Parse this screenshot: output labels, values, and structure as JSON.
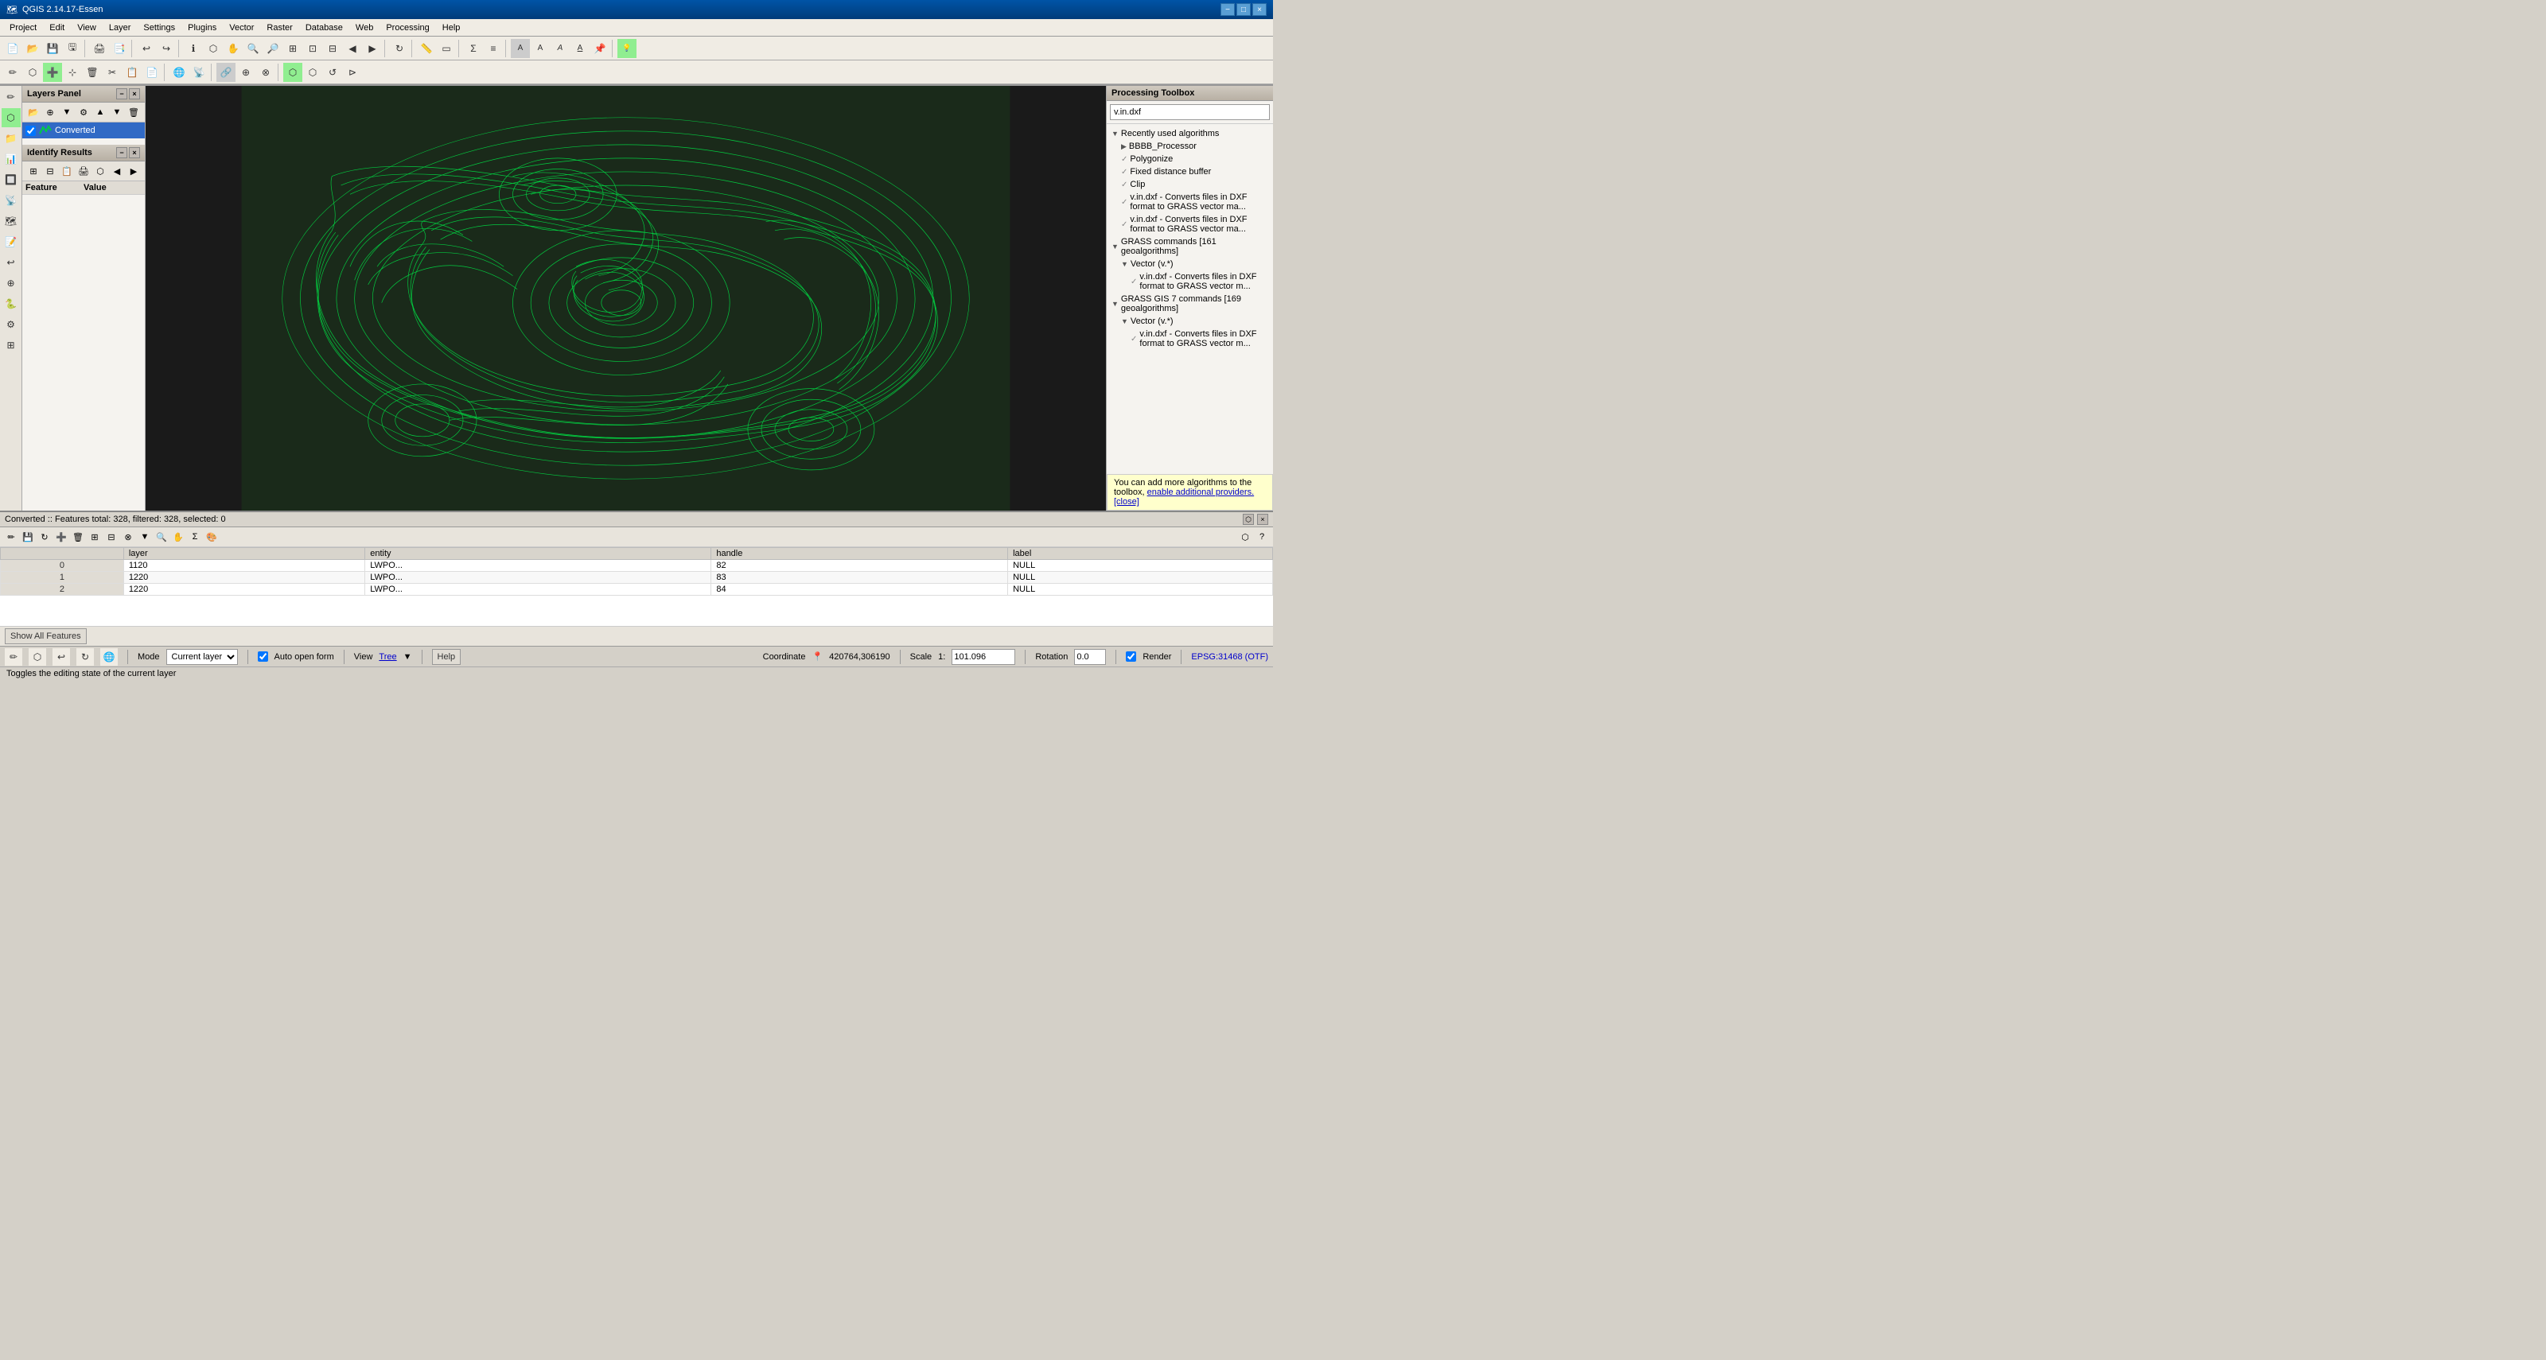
{
  "window": {
    "title": "QGIS 2.14.17-Essen",
    "minimize": "−",
    "maximize": "□",
    "close": "×"
  },
  "menu": {
    "items": [
      "Project",
      "Edit",
      "View",
      "Layer",
      "Settings",
      "Plugins",
      "Vector",
      "Raster",
      "Database",
      "Web",
      "Processing",
      "Help"
    ]
  },
  "layers_panel": {
    "title": "Layers Panel",
    "layers": [
      {
        "name": "Converted",
        "visible": true
      }
    ]
  },
  "identify_results": {
    "title": "Identify Results",
    "col_feature": "Feature",
    "col_value": "Value"
  },
  "processing_toolbox": {
    "title": "Processing Toolbox",
    "search_placeholder": "v.in.dxf",
    "sections": [
      {
        "label": "Recently used algorithms",
        "items": [
          {
            "label": "BBBB_Processor",
            "indent": 2
          },
          {
            "label": "Polygonize",
            "indent": 2
          },
          {
            "label": "Fixed distance buffer",
            "indent": 2
          },
          {
            "label": "Clip",
            "indent": 2
          },
          {
            "label": "v.in.dxf - Converts files in DXF format to GRASS vector ma...",
            "indent": 2
          },
          {
            "label": "v.in.dxf - Converts files in DXF format to GRASS vector ma...",
            "indent": 2
          }
        ]
      },
      {
        "label": "GRASS commands [161 geoalgorithms]",
        "items": [
          {
            "label": "Vector (v.*)",
            "indent": 2
          },
          {
            "label": "v.in.dxf - Converts files in DXF format to GRASS vector m...",
            "indent": 3
          }
        ]
      },
      {
        "label": "GRASS GIS 7 commands [169 geoalgorithms]",
        "items": [
          {
            "label": "Vector (v.*)",
            "indent": 2
          },
          {
            "label": "v.in.dxf - Converts files in DXF format to GRASS vector m...",
            "indent": 3
          }
        ]
      }
    ]
  },
  "attr_table": {
    "title": "Converted :: Features total: 328, filtered: 328, selected: 0",
    "columns": [
      "",
      "layer",
      "entity",
      "handle",
      "label"
    ],
    "rows": [
      {
        "row_num": "0",
        "layer": "1120",
        "entity": "LWPO...",
        "handle": "82",
        "label": "NULL"
      },
      {
        "row_num": "1",
        "layer": "1220",
        "entity": "LWPO...",
        "handle": "83",
        "label": "NULL"
      },
      {
        "row_num": "2",
        "layer": "1220",
        "entity": "LWPO...",
        "handle": "84",
        "label": "NULL"
      }
    ]
  },
  "statusbar": {
    "mode_label": "Mode",
    "mode_options": [
      "Current layer"
    ],
    "mode_current": "Current layer",
    "auto_open_form": "Auto open form",
    "view_label": "View",
    "tree_label": "Tree",
    "help_label": "Help",
    "show_all": "Show All Features",
    "coordinate_label": "Coordinate",
    "coordinate_value": "420764,306190",
    "scale_label": "Scale",
    "scale_value": "1:101.096",
    "rotation_label": "Rotation",
    "rotation_value": "0.0",
    "render_label": "Render",
    "epsg_label": "EPSG:31468 (OTF)",
    "toggle_editing_tip": "Toggles the editing state of the current layer"
  },
  "info_tip": {
    "text": "You can add more algorithms to the toolbox,",
    "link1": "enable additional providers.",
    "link2": "[close]"
  },
  "colors": {
    "accent_blue": "#316AC5",
    "green_lines": "#00cc44",
    "map_bg": "#1a1a1a"
  }
}
